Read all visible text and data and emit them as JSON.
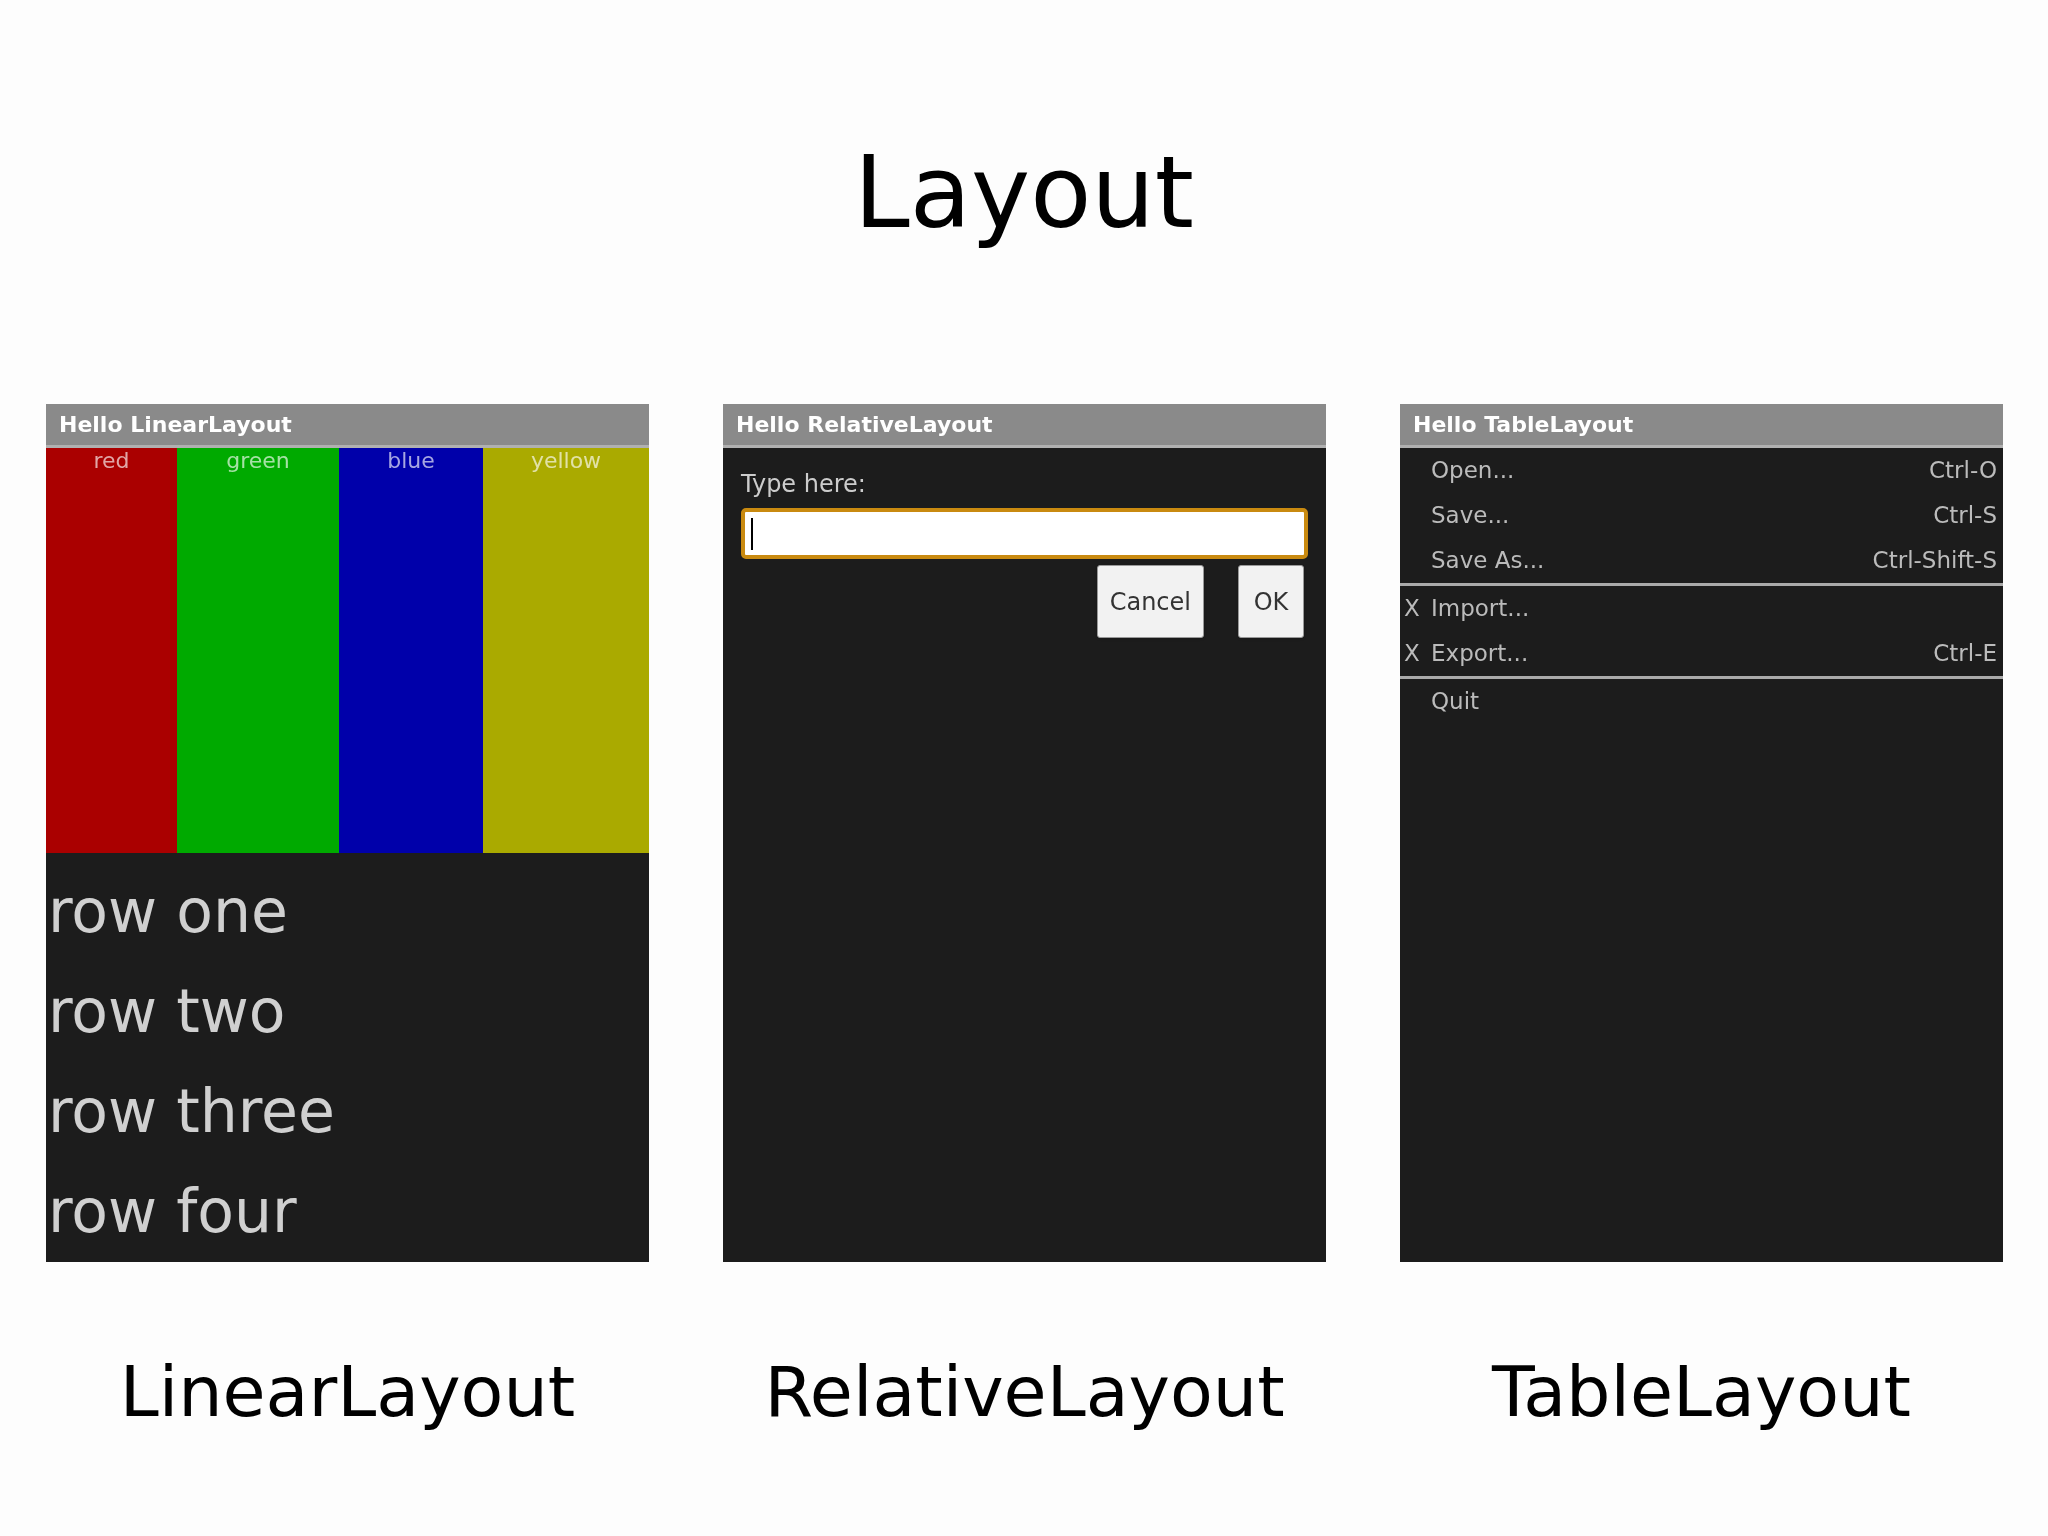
{
  "title": "Layout",
  "panels": [
    {
      "kind": "linear",
      "window_title": "Hello LinearLayout",
      "columns": [
        {
          "label": "red",
          "color": "#aa0000"
        },
        {
          "label": "green",
          "color": "#00aa00"
        },
        {
          "label": "blue",
          "color": "#0000aa"
        },
        {
          "label": "yellow",
          "color": "#aaaa00"
        }
      ],
      "rows": [
        "row one",
        "row two",
        "row three",
        "row four"
      ],
      "caption": "LinearLayout"
    },
    {
      "kind": "relative",
      "window_title": "Hello RelativeLayout",
      "field_label": "Type here:",
      "buttons": [
        "Cancel",
        "OK"
      ],
      "caption": "RelativeLayout"
    },
    {
      "kind": "table",
      "window_title": "Hello TableLayout",
      "groups": [
        [
          {
            "label": "Open...",
            "shortcut": "Ctrl-O"
          },
          {
            "label": "Save...",
            "shortcut": "Ctrl-S"
          },
          {
            "label": "Save As...",
            "shortcut": "Ctrl-Shift-S"
          }
        ],
        [
          {
            "mark": "X",
            "label": "Import..."
          },
          {
            "mark": "X",
            "label": "Export...",
            "shortcut": "Ctrl-E"
          }
        ],
        [
          {
            "label": "Quit"
          }
        ]
      ],
      "caption": "TableLayout"
    }
  ]
}
